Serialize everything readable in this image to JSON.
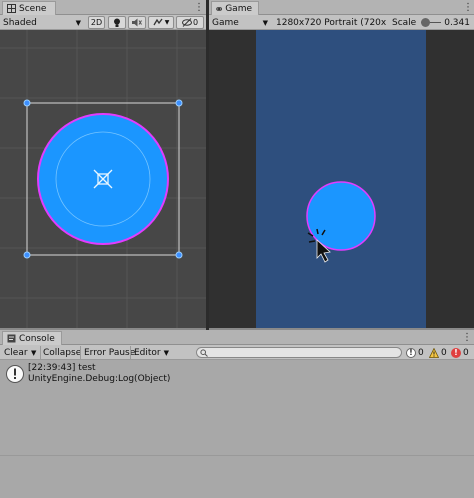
{
  "scene_panel": {
    "tab_label": "Scene",
    "shading_mode": "Shaded",
    "toggle_2d_label": "2D",
    "gizmos_value": "0"
  },
  "game_panel": {
    "tab_label": "Game",
    "display_value": "Game",
    "resolution_value": "1280x720 Portrait (720x1",
    "scale_label": "Scale",
    "scale_value": "0.341"
  },
  "console_panel": {
    "tab_label": "Console",
    "clear_label": "Clear",
    "collapse_label": "Collapse",
    "error_pause_label": "Error Pause",
    "editor_label": "Editor",
    "search_placeholder": "",
    "counters": [
      {
        "icon": "info-icon",
        "value": "0"
      },
      {
        "icon": "warning-icon",
        "value": "0"
      },
      {
        "icon": "error-icon",
        "value": "0"
      }
    ],
    "entries": [
      {
        "icon": "info-icon",
        "line1": "[22:39:43] test",
        "line2": "UnityEngine.Debug:Log(Object)"
      }
    ]
  },
  "colors": {
    "circle_fill": "#1b96ff",
    "circle_outline": "#e23cff",
    "game_bg": "#2e4f7e",
    "scene_bg": "#474747"
  }
}
